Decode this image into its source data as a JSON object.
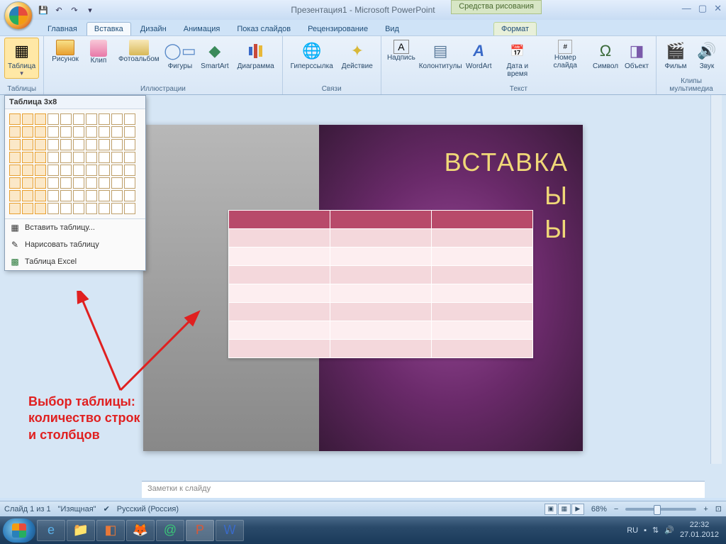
{
  "window": {
    "title": "Презентация1 - Microsoft PowerPoint",
    "context_tab": "Средства рисования"
  },
  "tabs": {
    "home": "Главная",
    "insert": "Вставка",
    "design": "Дизайн",
    "animation": "Анимация",
    "slideshow": "Показ слайдов",
    "review": "Рецензирование",
    "view": "Вид",
    "format": "Формат"
  },
  "ribbon": {
    "tables": {
      "label": "Таблицы",
      "table": "Таблица"
    },
    "illustrations": {
      "label": "Иллюстрации",
      "picture": "Рисунок",
      "clip": "Клип",
      "album": "Фотоальбом",
      "shapes": "Фигуры",
      "smartart": "SmartArt",
      "chart": "Диаграмма"
    },
    "links": {
      "label": "Связи",
      "hyperlink": "Гиперссылка",
      "action": "Действие"
    },
    "text": {
      "label": "Текст",
      "textbox": "Надпись",
      "headerfooter": "Колонтитулы",
      "wordart": "WordArt",
      "datetime": "Дата и время",
      "slidenum": "Номер слайда",
      "symbol": "Символ",
      "object": "Объект"
    },
    "media": {
      "label": "Клипы мультимедиа",
      "movie": "Фильм",
      "sound": "Звук"
    }
  },
  "table_dropdown": {
    "header": "Таблица 3x8",
    "sel_cols": 3,
    "sel_rows": 8,
    "insert": "Вставить таблицу...",
    "draw": "Нарисовать таблицу",
    "excel": "Таблица Excel"
  },
  "slide": {
    "title_line1": "ВСТАВКА",
    "title_line2": "Ы",
    "title_line3": "Ы"
  },
  "annotation": {
    "line1": "Выбор таблицы:",
    "line2": "количество строк",
    "line3": "и столбцов"
  },
  "notes": {
    "placeholder": "Заметки к слайду"
  },
  "statusbar": {
    "slide": "Слайд 1 из 1",
    "theme": "\"Изящная\"",
    "lang": "Русский (Россия)",
    "zoom": "68%"
  },
  "tray": {
    "lang": "RU",
    "time": "22:32",
    "date": "27.01.2012"
  }
}
